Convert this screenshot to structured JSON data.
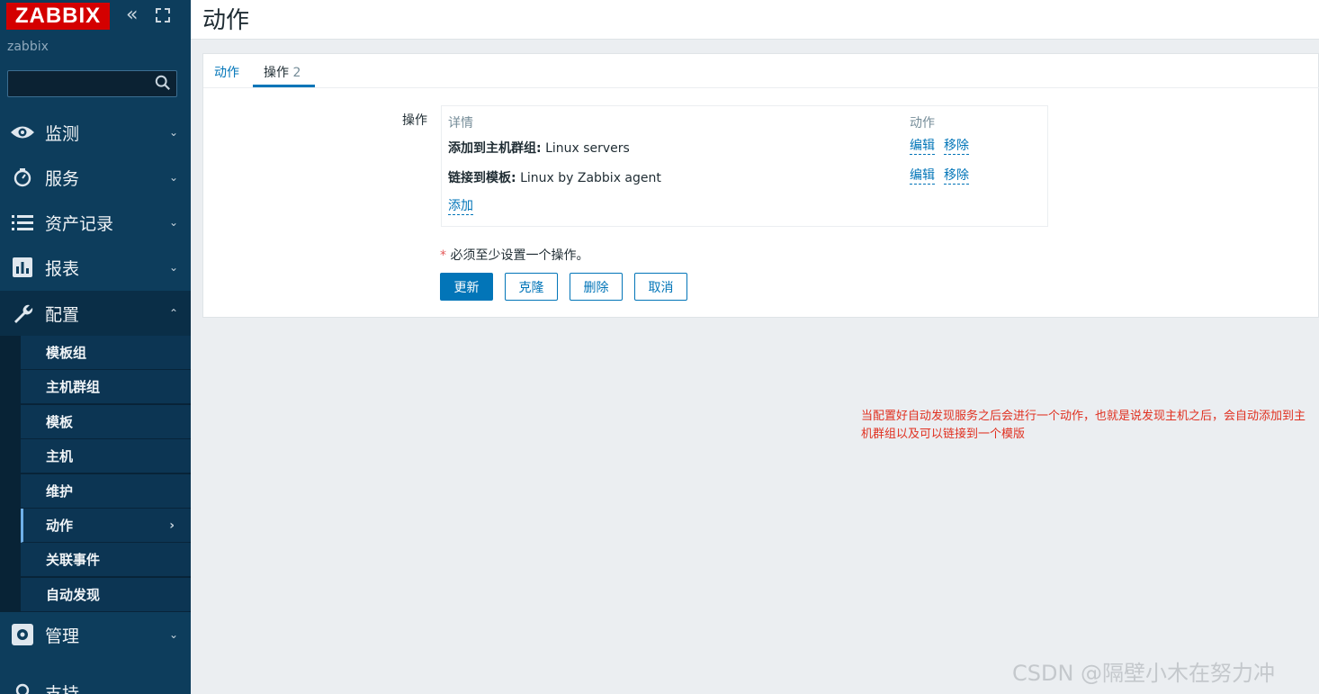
{
  "sidebar": {
    "logo": "ZABBIX",
    "collapse_icon": "double-chevron-left-icon",
    "kiosk_icon": "kiosk-mode-icon",
    "server_name": "zabbix",
    "search_placeholder": "",
    "menu": [
      {
        "label": "监测",
        "icon": "eye-icon"
      },
      {
        "label": "服务",
        "icon": "stopwatch-icon"
      },
      {
        "label": "资产记录",
        "icon": "list-icon"
      },
      {
        "label": "报表",
        "icon": "bar-chart-icon"
      },
      {
        "label": "配置",
        "icon": "wrench-icon"
      },
      {
        "label": "管理",
        "icon": "gear-icon"
      },
      {
        "label": "支持",
        "icon": "support-icon"
      }
    ],
    "submenu": [
      "模板组",
      "主机群组",
      "模板",
      "主机",
      "维护",
      "动作",
      "关联事件",
      "自动发现"
    ]
  },
  "page": {
    "title": "动作",
    "tabs": [
      {
        "label": "动作",
        "count": ""
      },
      {
        "label": "操作",
        "count": "2"
      }
    ],
    "operations_label": "操作",
    "table": {
      "headers": [
        "详情",
        "动作"
      ],
      "rows": [
        {
          "bold": "添加到主机群组:",
          "value": "Linux servers",
          "edit": "编辑",
          "remove": "移除"
        },
        {
          "bold": "链接到模板:",
          "value": "Linux by Zabbix agent",
          "edit": "编辑",
          "remove": "移除"
        }
      ],
      "add_link": "添加"
    },
    "required_note": "必须至少设置一个操作。",
    "buttons": {
      "update": "更新",
      "clone": "克隆",
      "delete": "删除",
      "cancel": "取消"
    }
  },
  "annotation": "当配置好自动发现服务之后会进行一个动作，也就是说发现主机之后，会自动添加到主机群组以及可以链接到一个模版",
  "watermark": "CSDN @隔壁小木在努力冲",
  "colors": {
    "sidebar": "#0d3d5c",
    "accent": "#0275b8",
    "logo": "#d40000",
    "annotation": "#e03020"
  }
}
